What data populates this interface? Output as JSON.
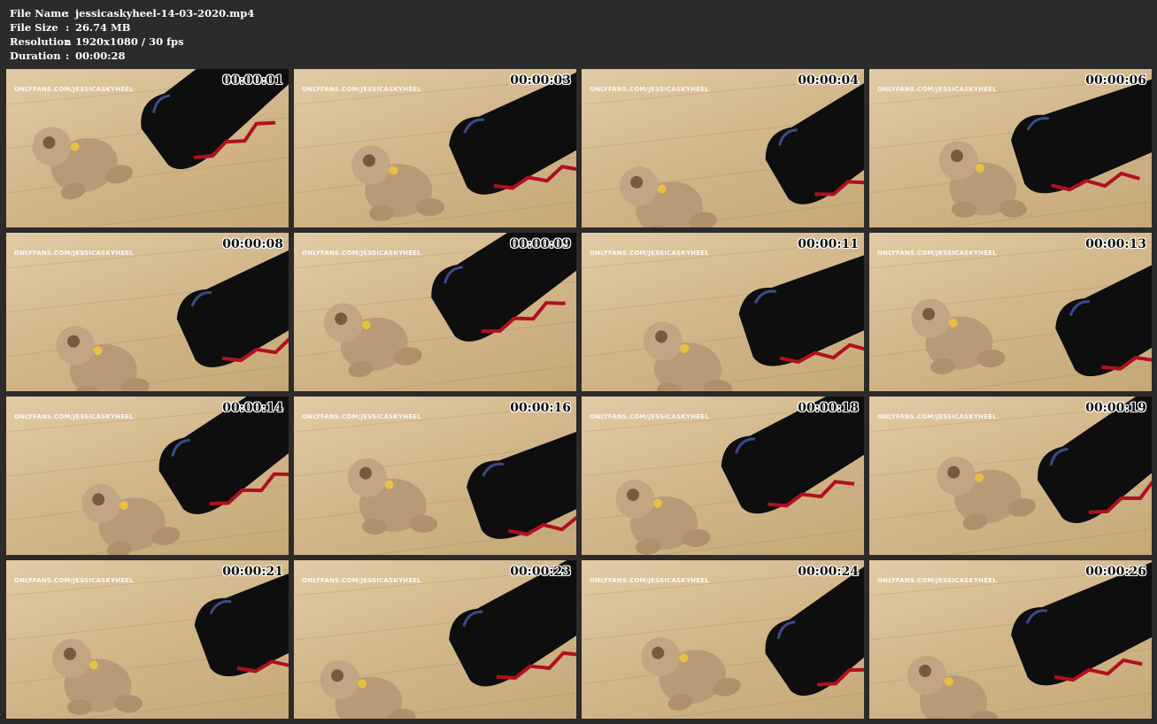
{
  "meta": {
    "file_name_label": "File Name",
    "file_name": "jessicaskyheel-14-03-2020.mp4",
    "file_size_label": "File Size",
    "file_size": "26.74 MB",
    "resolution_label": "Resolution",
    "resolution": "1920x1080 / 30 fps",
    "duration_label": "Duration",
    "duration": "00:00:28",
    "separator": ":"
  },
  "watermark": "ONLYFANS.COM/JESSICASKYHEEL",
  "thumbnails": [
    {
      "timestamp": "00:00:01"
    },
    {
      "timestamp": "00:00:03"
    },
    {
      "timestamp": "00:00:04"
    },
    {
      "timestamp": "00:00:06"
    },
    {
      "timestamp": "00:00:08"
    },
    {
      "timestamp": "00:00:09"
    },
    {
      "timestamp": "00:00:11"
    },
    {
      "timestamp": "00:00:13"
    },
    {
      "timestamp": "00:00:14"
    },
    {
      "timestamp": "00:00:16"
    },
    {
      "timestamp": "00:00:18"
    },
    {
      "timestamp": "00:00:19"
    },
    {
      "timestamp": "00:00:21"
    },
    {
      "timestamp": "00:00:23"
    },
    {
      "timestamp": "00:00:24"
    },
    {
      "timestamp": "00:00:26"
    }
  ],
  "colors": {
    "background": "#2b2b2b",
    "floor": "#d3b88c",
    "bear": "#b89a78",
    "boot": "#0e0e0e",
    "lacing": "#b01020"
  }
}
